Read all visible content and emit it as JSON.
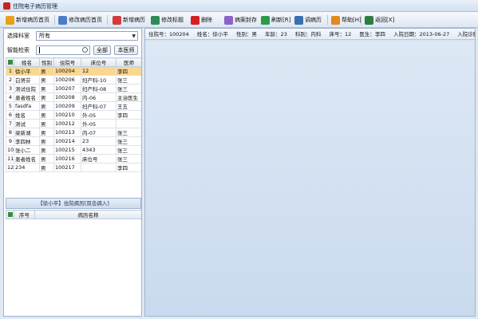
{
  "window": {
    "title": "住院电子病历管理"
  },
  "toolbar": [
    {
      "label": "新增病历首页",
      "color": "#e7a21a"
    },
    {
      "label": "修改病历首页",
      "color": "#4a7fc8"
    },
    {
      "label": "新增病历",
      "color": "#d23b3b"
    },
    {
      "label": "修改标题",
      "color": "#2e8b57"
    },
    {
      "label": "删除",
      "color": "#d42020"
    },
    {
      "label": "病案封存",
      "color": "#8a62c8"
    },
    {
      "label": "刷新[R]",
      "color": "#2b9a4a"
    },
    {
      "label": "调病历",
      "color": "#3b6fb0"
    },
    {
      "label": "帮助[H]",
      "color": "#e08a1f"
    },
    {
      "label": "返回[X]",
      "color": "#2f7d3f"
    }
  ],
  "filter": {
    "dept_label": "选择科室",
    "dept_value": "所有",
    "search_label": "智能检索",
    "search_value": "",
    "all_button": "全部",
    "dept_button": "本医师"
  },
  "patients": {
    "columns": [
      "姓名",
      "性别",
      "住院号",
      "床位号",
      "医师"
    ],
    "rows": [
      {
        "no": "1",
        "name": "徐小平",
        "sex": "男",
        "admission": "100204",
        "bed": "12",
        "doctor": "李四"
      },
      {
        "no": "2",
        "name": "白贤芬",
        "sex": "男",
        "admission": "100206",
        "bed": "妇产科-10",
        "doctor": "张三"
      },
      {
        "no": "3",
        "name": "测试住院",
        "sex": "男",
        "admission": "100207",
        "bed": "妇产科-08",
        "doctor": "张三"
      },
      {
        "no": "4",
        "name": "患者姓名",
        "sex": "男",
        "admission": "100208",
        "bed": "内-06",
        "doctor": "主治医生"
      },
      {
        "no": "5",
        "name": "fasdfa",
        "sex": "男",
        "admission": "100209",
        "bed": "妇产科-07",
        "doctor": "王五"
      },
      {
        "no": "6",
        "name": "姓名",
        "sex": "男",
        "admission": "100210",
        "bed": "外-05",
        "doctor": "李四"
      },
      {
        "no": "7",
        "name": "测试",
        "sex": "男",
        "admission": "100212",
        "bed": "外-05",
        "doctor": ""
      },
      {
        "no": "8",
        "name": "梁新湖",
        "sex": "男",
        "admission": "100213",
        "bed": "内-07",
        "doctor": "张三"
      },
      {
        "no": "9",
        "name": "李四林",
        "sex": "男",
        "admission": "100214",
        "bed": "23",
        "doctor": "张三"
      },
      {
        "no": "10",
        "name": "张小二",
        "sex": "男",
        "admission": "100215",
        "bed": "4343",
        "doctor": "张三"
      },
      {
        "no": "11",
        "name": "患者姓名",
        "sex": "男",
        "admission": "100216",
        "bed": "床位号",
        "doctor": "张三"
      },
      {
        "no": "12",
        "name": "234",
        "sex": "男",
        "admission": "100217",
        "bed": "",
        "doctor": "李四"
      }
    ]
  },
  "records": {
    "title": "【徐小平】住院病历[双击调入]",
    "columns": [
      "序号",
      "病历名称"
    ]
  },
  "info": {
    "admission": "住院号：100204",
    "name": "姓名：徐小平",
    "sex": "性别：男",
    "age": "年龄：23",
    "dept": "科别：内科",
    "bed": "床号：12",
    "doctor": "医生：李四",
    "date": "入院日期：2013-06-27",
    "diagnosis": "入院诊断：轻型旧典"
  }
}
